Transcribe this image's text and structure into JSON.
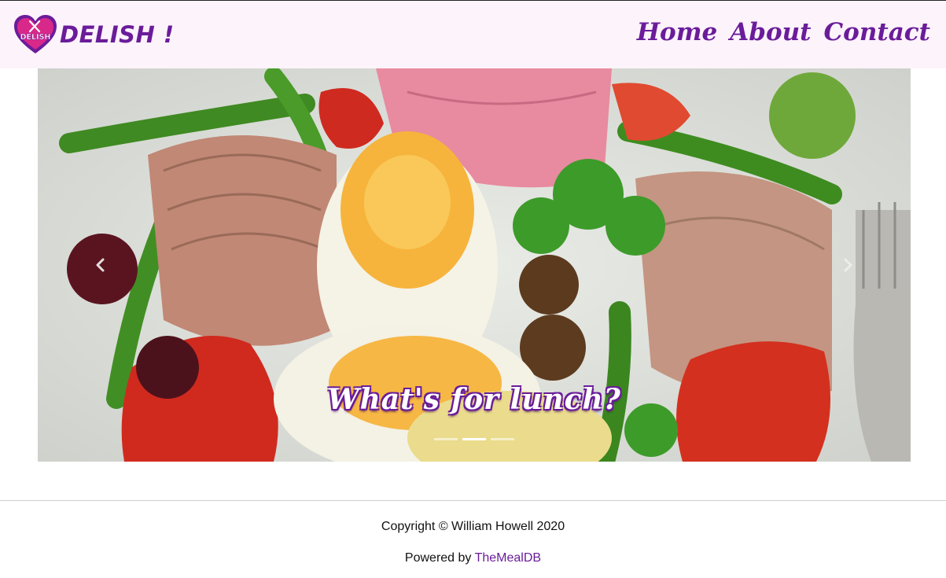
{
  "brand": {
    "logo_text": "DELISH",
    "name": "DELISH !"
  },
  "nav": {
    "items": [
      {
        "label": "Home"
      },
      {
        "label": "About"
      },
      {
        "label": "Contact"
      }
    ]
  },
  "carousel": {
    "caption": "What's for lunch?",
    "slide_count": 3,
    "active_index": 1,
    "prev_icon": "chevron-left-icon",
    "next_icon": "chevron-right-icon"
  },
  "footer": {
    "copyright": "Copyright © William Howell 2020",
    "powered_prefix": "Powered by ",
    "powered_link": "TheMealDB"
  },
  "colors": {
    "brand_purple": "#6a1c9a",
    "navbar_bg": "#fdf3fb",
    "logo_heart": "#d8288a"
  }
}
